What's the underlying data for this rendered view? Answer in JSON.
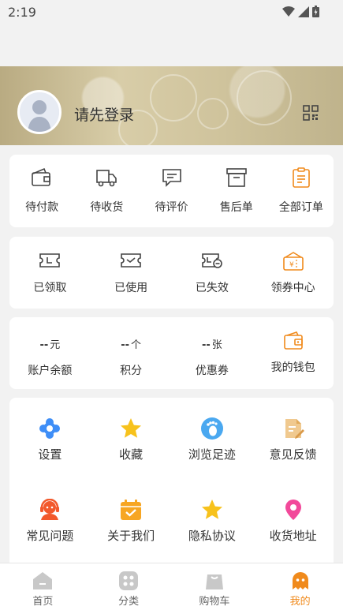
{
  "status_bar": {
    "time": "2:19"
  },
  "profile": {
    "login_prompt": "请先登录"
  },
  "orders": [
    {
      "label": "待付款",
      "icon": "wallet-icon"
    },
    {
      "label": "待收货",
      "icon": "truck-icon"
    },
    {
      "label": "待评价",
      "icon": "comment-icon"
    },
    {
      "label": "售后单",
      "icon": "box-icon"
    },
    {
      "label": "全部订单",
      "icon": "clipboard-icon"
    }
  ],
  "coupons": [
    {
      "label": "已领取",
      "icon": "ticket-icon"
    },
    {
      "label": "已使用",
      "icon": "ticket-check-icon"
    },
    {
      "label": "已失效",
      "icon": "ticket-expired-icon"
    },
    {
      "label": "领券中心",
      "icon": "coupon-center-icon"
    }
  ],
  "assets": [
    {
      "value": "--",
      "unit": "元",
      "label": "账户余额"
    },
    {
      "value": "--",
      "unit": "个",
      "label": "积分"
    },
    {
      "value": "--",
      "unit": "张",
      "label": "优惠券"
    },
    {
      "label": "我的钱包",
      "icon": "wallet-icon"
    }
  ],
  "services": [
    {
      "label": "设置",
      "icon": "gear-icon"
    },
    {
      "label": "收藏",
      "icon": "star-icon"
    },
    {
      "label": "浏览足迹",
      "icon": "footprint-icon"
    },
    {
      "label": "意见反馈",
      "icon": "feedback-icon"
    },
    {
      "label": "常见问题",
      "icon": "headset-icon"
    },
    {
      "label": "关于我们",
      "icon": "calendar-check-icon"
    },
    {
      "label": "隐私协议",
      "icon": "star-icon"
    },
    {
      "label": "收货地址",
      "icon": "location-pin-icon"
    }
  ],
  "tabs": [
    {
      "label": "首页",
      "icon": "home-icon"
    },
    {
      "label": "分类",
      "icon": "category-icon"
    },
    {
      "label": "购物车",
      "icon": "cart-icon"
    },
    {
      "label": "我的",
      "icon": "mine-icon",
      "active": true
    }
  ],
  "colors": {
    "accent": "#f08a1c",
    "icon_gray": "#444444",
    "tab_gray": "#c8c8c8"
  }
}
